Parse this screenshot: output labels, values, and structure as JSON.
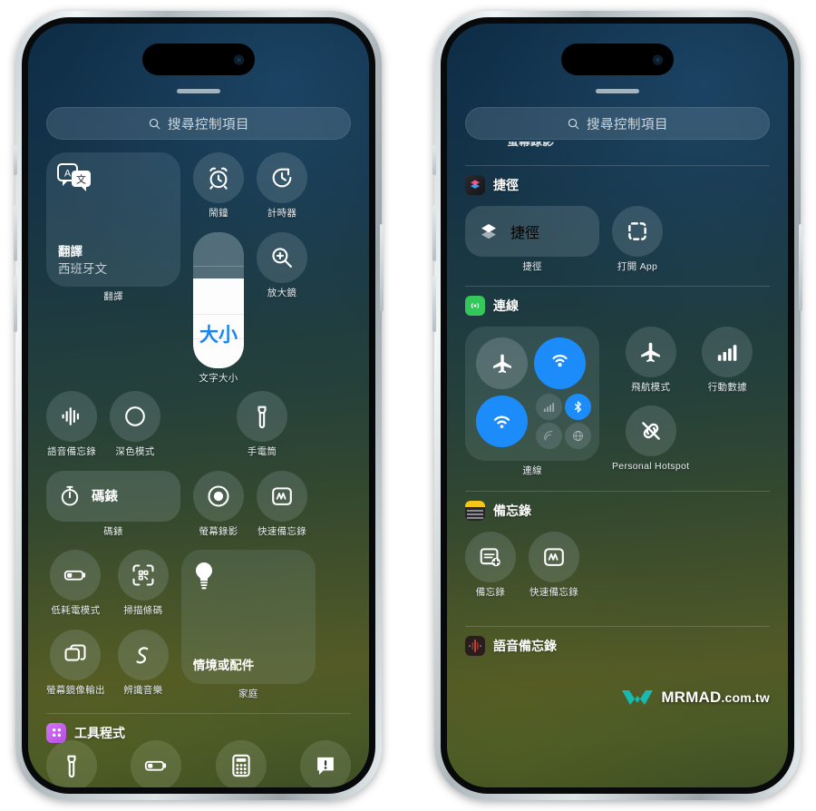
{
  "meta": {
    "app": "iOS Control Center",
    "watermark": "MRMAD",
    "watermark_suffix": ".com.tw"
  },
  "colors": {
    "accent_blue": "#1c8cfb",
    "slider_text_blue": "#1785f5",
    "utilities_badge": "#c45cf0",
    "connectivity_badge": "#34c759",
    "notes_badge": "#f5c518",
    "voice_memos_badge": "#d0443c",
    "shortcuts_badge": "#e0457b"
  },
  "phone_left": {
    "search": {
      "placeholder": "搜尋控制項目",
      "icon": "search-icon"
    },
    "translate_widget": {
      "title": "翻譯",
      "subtitle": "西班牙文",
      "caption": "翻譯",
      "icon": "translate-icon"
    },
    "alarm": {
      "caption": "鬧鐘",
      "icon": "alarm-clock-icon"
    },
    "timer": {
      "caption": "計時器",
      "icon": "timer-icon"
    },
    "magnifier": {
      "caption": "放大鏡",
      "icon": "magnifier-icon"
    },
    "voice_memo": {
      "caption": "語音備忘錄",
      "icon": "waveform-icon"
    },
    "dark_mode": {
      "caption": "深色模式",
      "icon": "dark-mode-icon"
    },
    "text_size": {
      "caption": "文字大小",
      "slider_label": "大小",
      "fill_percent": 66,
      "icon": "text-size-slider"
    },
    "flashlight": {
      "caption": "手電筒",
      "icon": "flashlight-icon"
    },
    "stopwatch": {
      "label": "碼錶",
      "caption": "碼錶",
      "icon": "stopwatch-icon"
    },
    "screen_record": {
      "caption": "螢幕錄影",
      "icon": "record-icon"
    },
    "quick_note": {
      "caption": "快速備忘錄",
      "icon": "quick-note-icon"
    },
    "low_power": {
      "caption": "低耗電模式",
      "icon": "battery-low-icon"
    },
    "scan_code": {
      "caption": "掃描條碼",
      "icon": "qr-scan-icon"
    },
    "home_widget": {
      "title": "情境或配件",
      "caption": "家庭",
      "icon": "lightbulb-icon"
    },
    "screen_mirror": {
      "caption": "螢幕鏡像輸出",
      "icon": "screen-mirror-icon"
    },
    "shazam": {
      "caption": "辨識音樂",
      "icon": "shazam-icon"
    },
    "utilities_section": {
      "title": "工具程式",
      "icon": "utilities-grid-icon"
    },
    "utility_bar": [
      {
        "name": "flashlight",
        "icon": "flashlight-icon"
      },
      {
        "name": "low-power",
        "icon": "battery-low-icon"
      },
      {
        "name": "calculator",
        "icon": "calculator-icon"
      },
      {
        "name": "alert",
        "icon": "alert-bubble-icon"
      }
    ]
  },
  "phone_right": {
    "search": {
      "placeholder": "搜尋控制項目",
      "icon": "search-icon"
    },
    "partial_label": "螢幕錄影",
    "shortcuts_section": {
      "title": "捷徑",
      "icon": "shortcuts-app-icon"
    },
    "shortcuts_pill": {
      "label": "捷徑",
      "caption": "捷徑",
      "icon": "shortcuts-icon"
    },
    "open_app": {
      "caption": "打開 App",
      "icon": "open-app-icon"
    },
    "connectivity_section": {
      "title": "連線",
      "icon": "connectivity-app-icon"
    },
    "connectivity_module": {
      "caption": "連線",
      "controls": [
        {
          "name": "airplane-mode",
          "state": "off",
          "icon": "airplane-icon"
        },
        {
          "name": "airdrop",
          "state": "on",
          "icon": "airdrop-icon"
        },
        {
          "name": "wifi",
          "state": "on",
          "icon": "wifi-icon"
        },
        {
          "name": "cellular",
          "state": "dim",
          "icon": "cellular-bars-icon"
        },
        {
          "name": "bluetooth",
          "state": "on",
          "icon": "bluetooth-icon"
        },
        {
          "name": "satellite",
          "state": "dim",
          "icon": "satellite-icon"
        },
        {
          "name": "vpn",
          "state": "dim",
          "icon": "vpn-icon"
        }
      ]
    },
    "airplane_mode": {
      "caption": "飛航模式",
      "icon": "airplane-icon"
    },
    "cellular_data": {
      "caption": "行動數據",
      "icon": "cellular-bars-icon"
    },
    "personal_hotspot": {
      "caption": "Personal Hotspot",
      "icon": "hotspot-off-icon"
    },
    "notes_section": {
      "title": "備忘錄",
      "icon": "notes-app-icon"
    },
    "new_note": {
      "caption": "備忘錄",
      "icon": "new-note-icon"
    },
    "quick_note": {
      "caption": "快速備忘錄",
      "icon": "quick-note-icon"
    },
    "voice_memos_section": {
      "title": "語音備忘錄",
      "icon": "voice-memos-app-icon"
    }
  }
}
